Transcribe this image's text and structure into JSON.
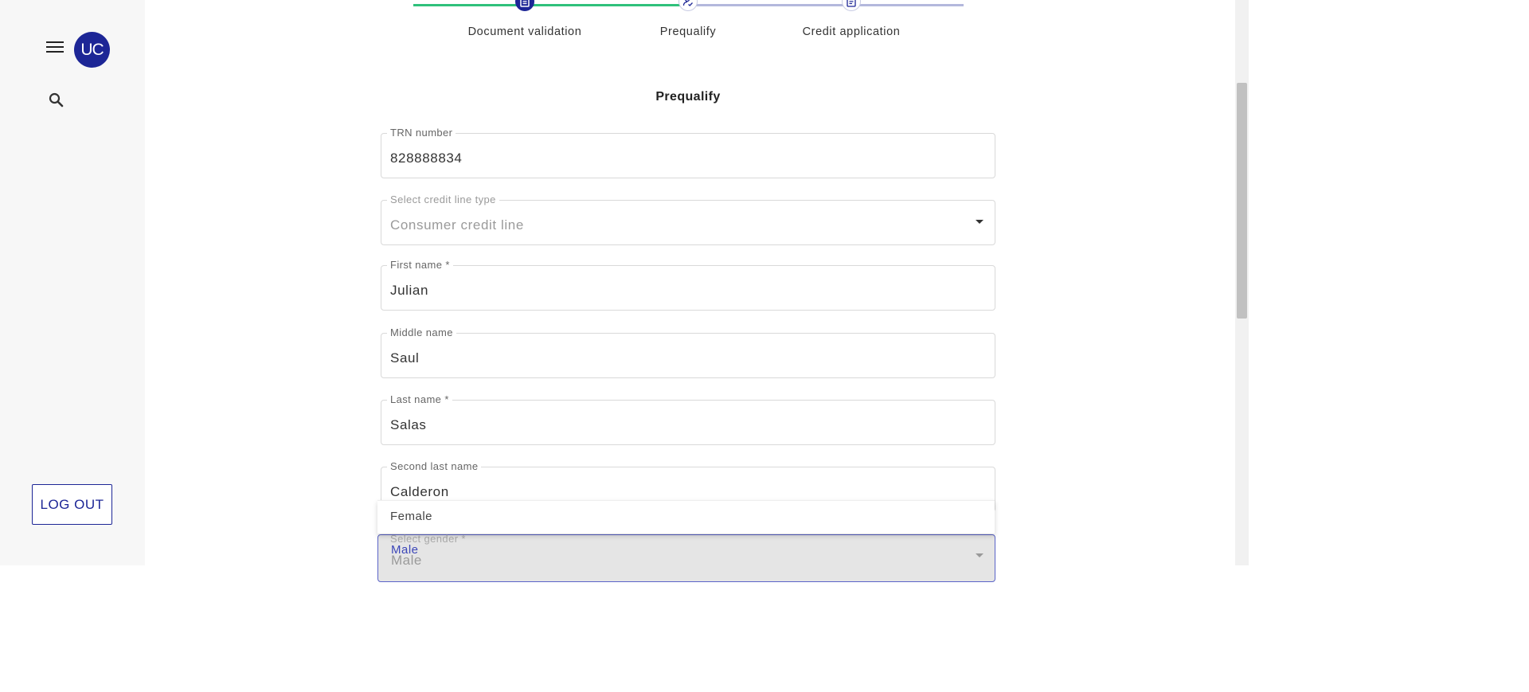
{
  "sidebar": {
    "menu_icon": "hamburger-menu-icon",
    "avatar_initials": "UC",
    "search_icon": "search-icon",
    "logout_label": "LOG OUT"
  },
  "stepper": {
    "steps": [
      {
        "label": "Document validation",
        "icon": "document-icon",
        "state": "active"
      },
      {
        "label": "Prequalify",
        "icon": "person-check-icon",
        "state": "pending"
      },
      {
        "label": "Credit application",
        "icon": "document-list-icon",
        "state": "pending"
      }
    ],
    "colors": {
      "complete": "#2fc17b",
      "pending": "#b3b8dc",
      "active": "#1d2696"
    }
  },
  "form": {
    "title": "Prequalify",
    "fields": [
      {
        "label": "TRN number",
        "value": "828888834"
      },
      {
        "label": "Select credit line type",
        "value": "Consumer credit line"
      },
      {
        "label": "First name *",
        "value": "Julian"
      },
      {
        "label": "Middle name",
        "value": "Saul"
      },
      {
        "label": "Last name *",
        "value": "Salas"
      },
      {
        "label": "Second last name",
        "value": "Calderon"
      }
    ],
    "gender": {
      "label": "Select gender *",
      "highlighted_option": "Male",
      "value": "Male",
      "menu_options": [
        "Female"
      ]
    }
  },
  "colors": {
    "brand": "#1d2696",
    "sidebar_bg": "#f7f7f7"
  }
}
